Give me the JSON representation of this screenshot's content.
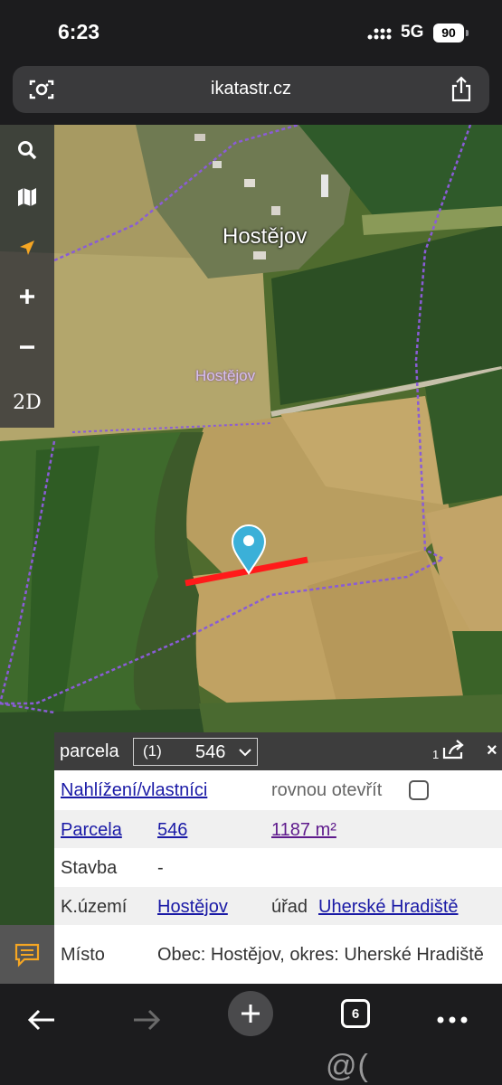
{
  "status": {
    "time": "6:23",
    "network": "5G",
    "battery": "90"
  },
  "browser": {
    "url": "ikatastr.cz",
    "tab_count": "6"
  },
  "map": {
    "town_label": "Hostějov",
    "area_label": "Hostějov"
  },
  "toolbar": {
    "view_mode": "2D"
  },
  "panel": {
    "title": "parcela",
    "select_index": "(1)",
    "select_number": "546",
    "result_count": "1",
    "close_label": "×",
    "rows": {
      "lookup_link": "Nahlížení/vlastníci",
      "open_directly": "rovnou otevřít",
      "parcel_label": "Parcela",
      "parcel_number": "546",
      "parcel_area": "1187 m²",
      "building_label": "Stavba",
      "building_value": "-",
      "territory_label": "K.území",
      "territory_value": "Hostějov",
      "office_prefix": "úřad",
      "office_value": "Uherské Hradiště",
      "place_label": "Místo",
      "place_value": "Obec: Hostějov, okres: Uherské Hradiště"
    }
  },
  "watermark": "@( Bazos.cz",
  "colors": {
    "parcel_line": "#ff1a1a",
    "pin": "#3bb0d8",
    "boundary": "#8a5cd6"
  }
}
